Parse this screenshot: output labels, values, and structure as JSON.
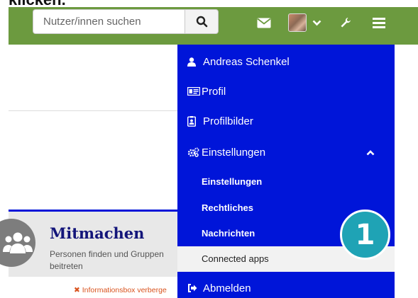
{
  "caption": "klicken.",
  "search": {
    "placeholder": "Nutzer/innen suchen"
  },
  "menu": {
    "user_name": "Andreas Schenkel",
    "profile": "Profil",
    "profile_pictures": "Profilbilder",
    "settings": "Einstellungen",
    "sub_settings": "Einstellungen",
    "legal": "Rechtliches",
    "messages": "Nachrichten",
    "connected_apps": "Connected apps",
    "logout": "Abmelden"
  },
  "panel": {
    "title": "Mitmachen",
    "subtitle": "Personen finden und Gruppen beitreten",
    "hide_link": "✖ Informationsbox verberge"
  },
  "badge": {
    "number": "1"
  },
  "colors": {
    "topbar": "#6c9a3f",
    "menu": "#0015d9",
    "badge": "#1fa3b5"
  }
}
